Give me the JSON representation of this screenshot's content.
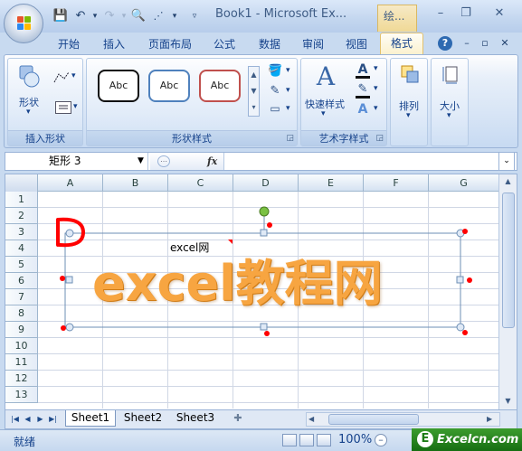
{
  "window": {
    "title": "Book1 - Microsoft Ex...",
    "context_tab_group": "绘..."
  },
  "tabs": [
    {
      "id": "home",
      "label": "开始"
    },
    {
      "id": "insert",
      "label": "插入"
    },
    {
      "id": "layout",
      "label": "页面布局"
    },
    {
      "id": "formulas",
      "label": "公式"
    },
    {
      "id": "data",
      "label": "数据"
    },
    {
      "id": "review",
      "label": "审阅"
    },
    {
      "id": "view",
      "label": "视图"
    },
    {
      "id": "format",
      "label": "格式",
      "active": true
    }
  ],
  "ribbon": {
    "insert_shapes": {
      "group_label": "插入形状",
      "shapes_label": "形状"
    },
    "shape_styles": {
      "group_label": "形状样式",
      "samples": [
        "Abc",
        "Abc",
        "Abc"
      ],
      "sample_colors": [
        "#111111",
        "#4f81bd",
        "#c0504d"
      ]
    },
    "wordart": {
      "group_label": "艺术字样式",
      "quick_styles_label": "快速样式"
    },
    "arrange": {
      "label": "排列"
    },
    "size": {
      "label": "大小"
    }
  },
  "formula_bar": {
    "name_box": "矩形 3",
    "fx": "fx",
    "formula": ""
  },
  "sheet": {
    "columns": [
      "A",
      "B",
      "C",
      "D",
      "E",
      "F",
      "G"
    ],
    "rows": [
      "1",
      "2",
      "3",
      "4",
      "5",
      "6",
      "7",
      "8",
      "9",
      "10",
      "11",
      "12",
      "13"
    ],
    "shape_text": "excel教程网",
    "comment_text": "excel网",
    "annotation": "D"
  },
  "sheet_tabs": [
    "Sheet1",
    "Sheet2",
    "Sheet3"
  ],
  "status": {
    "ready": "就绪",
    "zoom": "100%"
  },
  "watermark": {
    "icon": "E",
    "text": "Excelcn.com"
  },
  "colors": {
    "accent": "#15428b",
    "wordart_orange": "#f7a541",
    "annotation_red": "#ff0000",
    "rotation_handle": "#7ac143"
  }
}
